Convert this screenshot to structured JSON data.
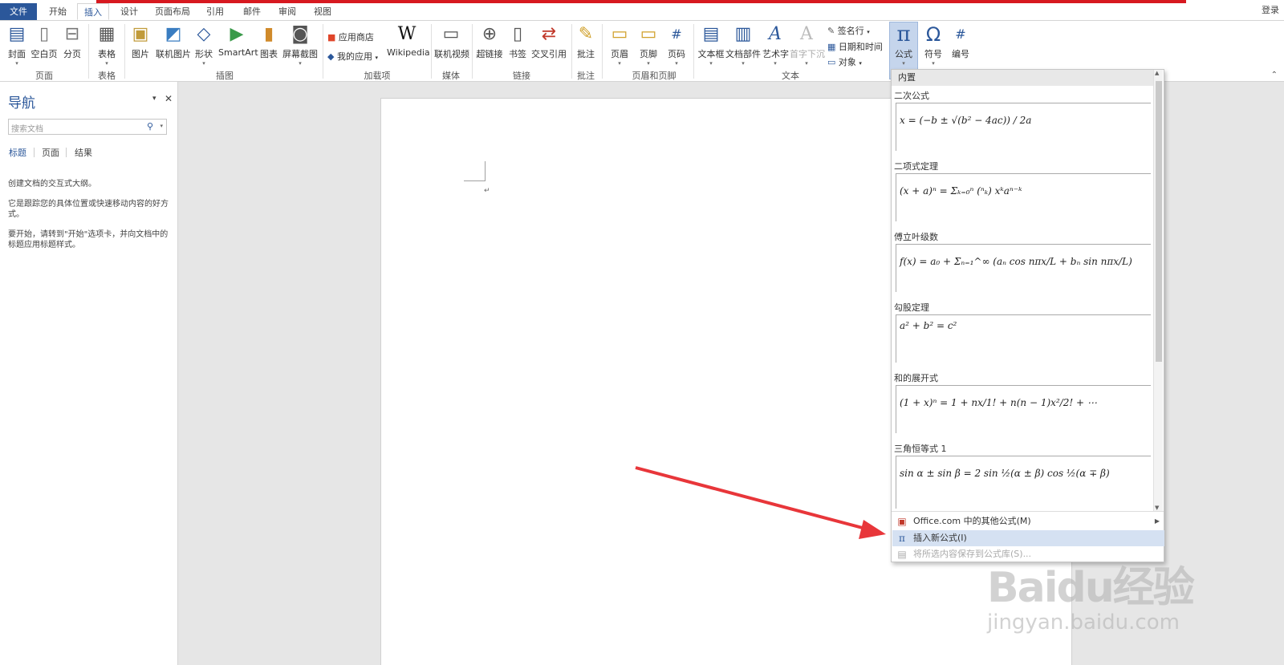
{
  "tabs": [
    "文件",
    "开始",
    "插入",
    "设计",
    "页面布局",
    "引用",
    "邮件",
    "审阅",
    "视图"
  ],
  "login": "登录",
  "ribbon": {
    "buttons": [
      "封面",
      "空白页",
      "分页",
      "表格",
      "图片",
      "联机图片",
      "形状",
      "SmartArt",
      "图表",
      "屏幕截图",
      "Wikipedia",
      "联机视频",
      "超链接",
      "书签",
      "交叉引用",
      "批注",
      "页眉",
      "页脚",
      "页码",
      "文本框",
      "文档部件",
      "艺术字",
      "首字下沉",
      "公式",
      "符号",
      "编号"
    ],
    "small": [
      "应用商店",
      "我的应用",
      "签名行",
      "日期和时间",
      "对象"
    ],
    "groups": [
      "页面",
      "表格",
      "插图",
      "加载项",
      "媒体",
      "链接",
      "批注",
      "页眉和页脚",
      "文本"
    ]
  },
  "nav": {
    "title": "导航",
    "search_placeholder": "搜索文档",
    "tabs": [
      "标题",
      "页面",
      "结果"
    ],
    "text1": "创建文档的交互式大纲。",
    "text2": "它是跟踪您的具体位置或快速移动内容的好方式。",
    "text3": "要开始，请转到\"开始\"选项卡，并向文档中的标题应用标题样式。"
  },
  "document": {
    "mark": "↵"
  },
  "dropdown": {
    "header": "内置",
    "equations": [
      {
        "label": "二次公式",
        "formula": "x = (−b ± √(b² − 4ac)) / 2a"
      },
      {
        "label": "二项式定理",
        "formula": "(x + a)ⁿ = Σₖ₌₀ⁿ (ⁿₖ) xᵏaⁿ⁻ᵏ"
      },
      {
        "label": "傅立叶级数",
        "formula": "f(x) = a₀ + Σₙ₌₁^∞ (aₙ cos nπx/L + bₙ sin nπx/L)"
      },
      {
        "label": "勾股定理",
        "formula": "a² + b² = c²"
      },
      {
        "label": "和的展开式",
        "formula": "(1 + x)ⁿ = 1 + nx/1! + n(n − 1)x²/2! + ⋯"
      },
      {
        "label": "三角恒等式 1",
        "formula": "sin α ± sin β = 2 sin ½(α ± β) cos ½(α ∓ β)"
      }
    ],
    "menu": [
      "Office.com 中的其他公式(M)",
      "插入新公式(I)",
      "将所选内容保存到公式库(S)..."
    ]
  },
  "watermark": {
    "brand": "Baidu经验",
    "url": "jingyan.baidu.com"
  },
  "colors": {
    "accent": "#2b579a",
    "arrow": "#e8363a",
    "highlight": "#d5e1f2"
  }
}
